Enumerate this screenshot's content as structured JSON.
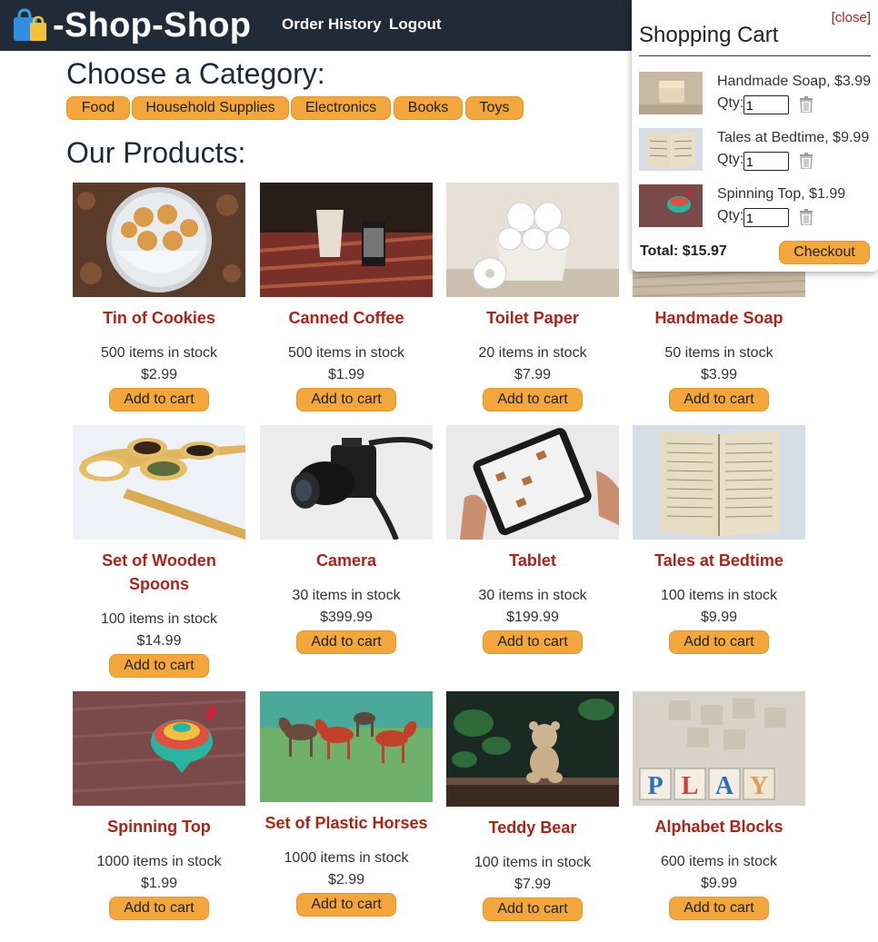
{
  "app": {
    "brand": "-Shop-Shop"
  },
  "nav": {
    "order_history": "Order History",
    "logout": "Logout"
  },
  "categories": {
    "title": "Choose a Category:",
    "items": [
      "Food",
      "Household Supplies",
      "Electronics",
      "Books",
      "Toys"
    ]
  },
  "products_title": "Our Products:",
  "products": [
    {
      "name": "Tin of Cookies",
      "stock": "500 items in stock",
      "price": "$2.99",
      "button": "Add to cart"
    },
    {
      "name": "Canned Coffee",
      "stock": "500 items in stock",
      "price": "$1.99",
      "button": "Add to cart"
    },
    {
      "name": "Toilet Paper",
      "stock": "20 items in stock",
      "price": "$7.99",
      "button": "Add to cart"
    },
    {
      "name": "Handmade Soap",
      "stock": "50 items in stock",
      "price": "$3.99",
      "button": "Add to cart"
    },
    {
      "name": "Set of Wooden Spoons",
      "stock": "100 items in stock",
      "price": "$14.99",
      "button": "Add to cart"
    },
    {
      "name": "Camera",
      "stock": "30 items in stock",
      "price": "$399.99",
      "button": "Add to cart"
    },
    {
      "name": "Tablet",
      "stock": "30 items in stock",
      "price": "$199.99",
      "button": "Add to cart"
    },
    {
      "name": "Tales at Bedtime",
      "stock": "100 items in stock",
      "price": "$9.99",
      "button": "Add to cart"
    },
    {
      "name": "Spinning Top",
      "stock": "1000 items in stock",
      "price": "$1.99",
      "button": "Add to cart"
    },
    {
      "name": "Set of Plastic Horses",
      "stock": "1000 items in stock",
      "price": "$2.99",
      "button": "Add to cart"
    },
    {
      "name": "Teddy Bear",
      "stock": "100 items in stock",
      "price": "$7.99",
      "button": "Add to cart"
    },
    {
      "name": "Alphabet Blocks",
      "stock": "600 items in stock",
      "price": "$9.99",
      "button": "Add to cart"
    }
  ],
  "cart": {
    "close": "[close]",
    "title": "Shopping Cart",
    "qty_label": "Qty:",
    "items": [
      {
        "desc": "Handmade Soap, $3.99",
        "qty": "1"
      },
      {
        "desc": "Tales at Bedtime, $9.99",
        "qty": "1"
      },
      {
        "desc": "Spinning Top, $1.99",
        "qty": "1"
      }
    ],
    "total": "Total: $15.97",
    "checkout": "Checkout"
  },
  "colors": {
    "header_bg": "#212b38",
    "accent_button": "#f3a63c",
    "product_name": "#a5261a"
  }
}
